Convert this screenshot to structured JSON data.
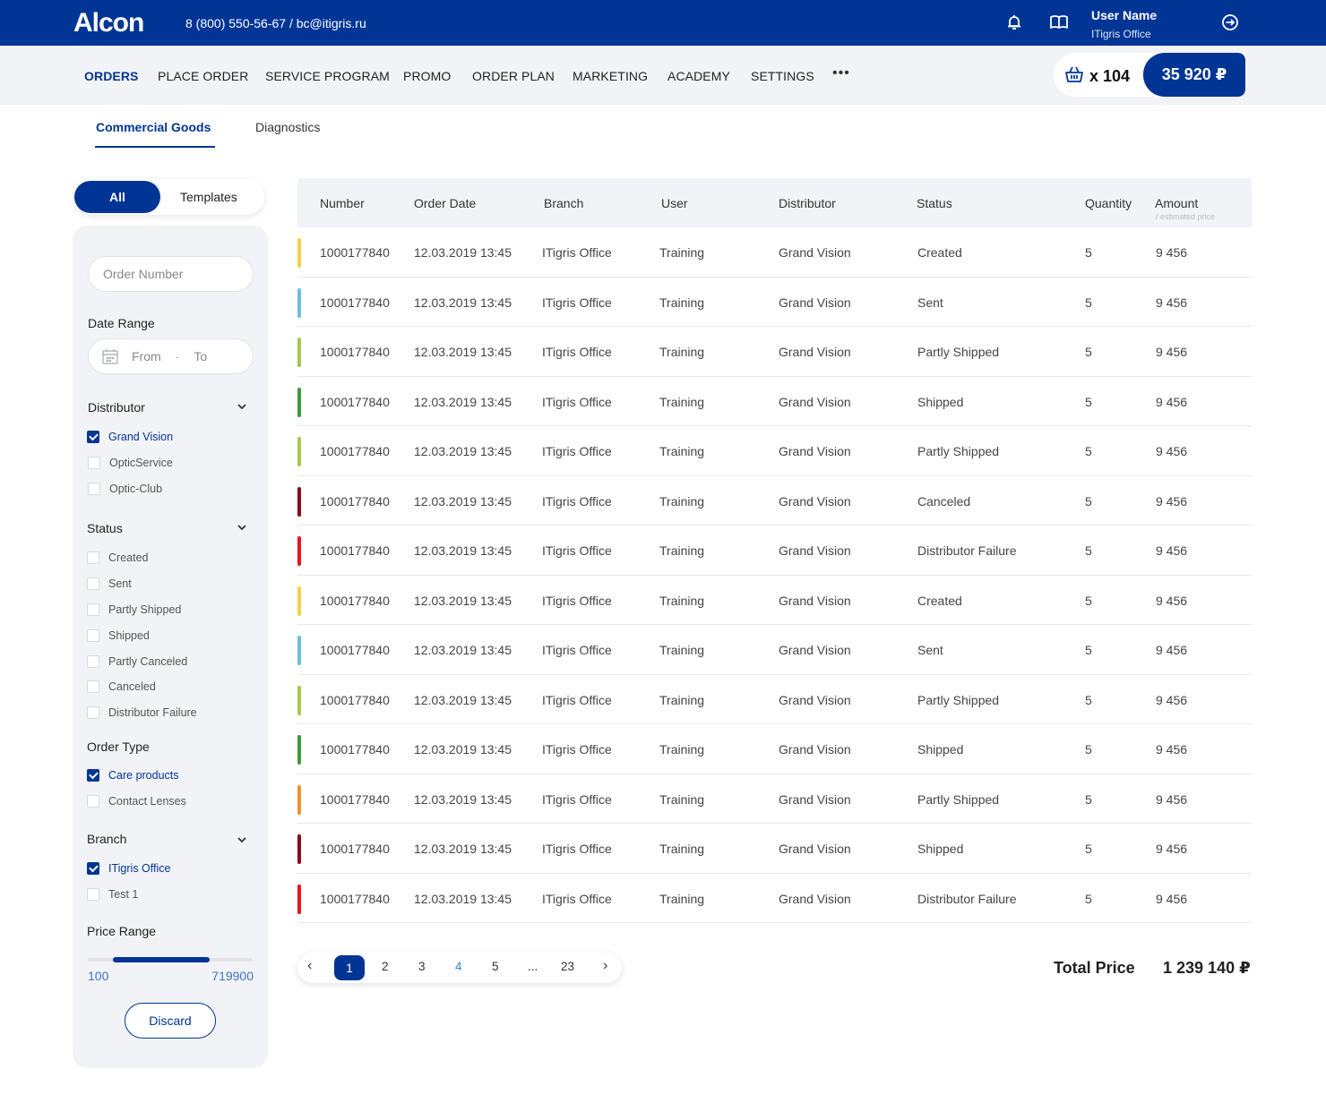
{
  "header": {
    "logo": "Alcon",
    "contact": "8 (800) 550-56-67 / bc@itigris.ru",
    "user_name": "User Name",
    "user_office": "ITigris Office"
  },
  "nav": {
    "items": [
      "ORDERS",
      "PLACE ORDER",
      "SERVICE PROGRAM",
      "PROMO",
      "ORDER PLAN",
      "MARKETING",
      "ACADEMY",
      "SETTINGS"
    ],
    "more": "•••",
    "cart_count": "x 104",
    "cart_total": "35 920 ₽"
  },
  "tabs": [
    "Commercial Goods",
    "Diagnostics"
  ],
  "segment": {
    "all": "All",
    "templates": "Templates"
  },
  "filters": {
    "order_number_placeholder": "Order Number",
    "date_range_label": "Date Range",
    "date_from": "From",
    "date_sep": "-",
    "date_to": "To",
    "distributor_label": "Distributor",
    "distributors": [
      {
        "label": "Grand Vision",
        "checked": true
      },
      {
        "label": "OpticService",
        "checked": false
      },
      {
        "label": "Optic-Club",
        "checked": false
      }
    ],
    "status_label": "Status",
    "statuses": [
      {
        "label": "Created",
        "checked": false
      },
      {
        "label": "Sent",
        "checked": false
      },
      {
        "label": "Partly Shipped",
        "checked": false
      },
      {
        "label": "Shipped",
        "checked": false
      },
      {
        "label": "Partly Canceled",
        "checked": false
      },
      {
        "label": "Canceled",
        "checked": false
      },
      {
        "label": "Distributor Failure",
        "checked": false
      }
    ],
    "order_type_label": "Order Type",
    "order_types": [
      {
        "label": "Care products",
        "checked": true
      },
      {
        "label": "Contact Lenses",
        "checked": false
      }
    ],
    "branch_label": "Branch",
    "branches": [
      {
        "label": "ITigris Office",
        "checked": true
      },
      {
        "label": "Test 1",
        "checked": false
      }
    ],
    "price_range_label": "Price Range",
    "price_min": "100",
    "price_max": "719900",
    "price_selected_fraction": [
      0.15,
      0.74
    ],
    "discard": "Discard"
  },
  "table": {
    "headers": [
      "Number",
      "Order Date",
      "Branch",
      "User",
      "Distributor",
      "Status",
      "Quantity",
      "Amount"
    ],
    "amount_sub": "/ estimated price",
    "status_colors": {
      "Created": "#f6d04d",
      "Sent": "#6cc0d6",
      "Partly Shipped": "#a4c94a",
      "Shipped": "#3d9a3d",
      "Canceled": "#8b0a1a",
      "Distributor Failure": "#e8141b",
      "Partly Shipped Alt": "#f0922e"
    },
    "rows": [
      {
        "number": "1000177840",
        "date": "12.03.2019 13:45",
        "branch": "ITigris Office",
        "user": "Training",
        "distributor": "Grand Vision",
        "status": "Created",
        "quantity": "5",
        "amount": "9 456",
        "color": "#f6d04d"
      },
      {
        "number": "1000177840",
        "date": "12.03.2019 13:45",
        "branch": "ITigris Office",
        "user": "Training",
        "distributor": "Grand Vision",
        "status": "Sent",
        "quantity": "5",
        "amount": "9 456",
        "color": "#6cc0d6"
      },
      {
        "number": "1000177840",
        "date": "12.03.2019 13:45",
        "branch": "ITigris Office",
        "user": "Training",
        "distributor": "Grand Vision",
        "status": "Partly Shipped",
        "quantity": "5",
        "amount": "9 456",
        "color": "#a4c94a"
      },
      {
        "number": "1000177840",
        "date": "12.03.2019 13:45",
        "branch": "ITigris Office",
        "user": "Training",
        "distributor": "Grand Vision",
        "status": "Shipped",
        "quantity": "5",
        "amount": "9 456",
        "color": "#3d9a3d"
      },
      {
        "number": "1000177840",
        "date": "12.03.2019 13:45",
        "branch": "ITigris Office",
        "user": "Training",
        "distributor": "Grand Vision",
        "status": "Partly Shipped",
        "quantity": "5",
        "amount": "9 456",
        "color": "#a4c94a"
      },
      {
        "number": "1000177840",
        "date": "12.03.2019 13:45",
        "branch": "ITigris Office",
        "user": "Training",
        "distributor": "Grand Vision",
        "status": "Canceled",
        "quantity": "5",
        "amount": "9 456",
        "color": "#8b0a1a"
      },
      {
        "number": "1000177840",
        "date": "12.03.2019 13:45",
        "branch": "ITigris Office",
        "user": "Training",
        "distributor": "Grand Vision",
        "status": "Distributor Failure",
        "quantity": "5",
        "amount": "9 456",
        "color": "#e8141b"
      },
      {
        "number": "1000177840",
        "date": "12.03.2019 13:45",
        "branch": "ITigris Office",
        "user": "Training",
        "distributor": "Grand Vision",
        "status": "Created",
        "quantity": "5",
        "amount": "9 456",
        "color": "#f6d04d"
      },
      {
        "number": "1000177840",
        "date": "12.03.2019 13:45",
        "branch": "ITigris Office",
        "user": "Training",
        "distributor": "Grand Vision",
        "status": "Sent",
        "quantity": "5",
        "amount": "9 456",
        "color": "#6cc0d6"
      },
      {
        "number": "1000177840",
        "date": "12.03.2019 13:45",
        "branch": "ITigris Office",
        "user": "Training",
        "distributor": "Grand Vision",
        "status": "Partly Shipped",
        "quantity": "5",
        "amount": "9 456",
        "color": "#a4c94a"
      },
      {
        "number": "1000177840",
        "date": "12.03.2019 13:45",
        "branch": "ITigris Office",
        "user": "Training",
        "distributor": "Grand Vision",
        "status": "Shipped",
        "quantity": "5",
        "amount": "9 456",
        "color": "#3d9a3d"
      },
      {
        "number": "1000177840",
        "date": "12.03.2019 13:45",
        "branch": "ITigris Office",
        "user": "Training",
        "distributor": "Grand Vision",
        "status": "Partly Shipped",
        "quantity": "5",
        "amount": "9 456",
        "color": "#f0922e"
      },
      {
        "number": "1000177840",
        "date": "12.03.2019 13:45",
        "branch": "ITigris Office",
        "user": "Training",
        "distributor": "Grand Vision",
        "status": "Shipped",
        "quantity": "5",
        "amount": "9 456",
        "color": "#8b0a1a"
      },
      {
        "number": "1000177840",
        "date": "12.03.2019 13:45",
        "branch": "ITigris Office",
        "user": "Training",
        "distributor": "Grand Vision",
        "status": "Distributor Failure",
        "quantity": "5",
        "amount": "9 456",
        "color": "#e8141b"
      }
    ]
  },
  "pagination": {
    "prev": "‹",
    "pages": [
      "1",
      "2",
      "3",
      "4",
      "5",
      "...",
      "23"
    ],
    "current": "1",
    "highlight": "4",
    "next": "›"
  },
  "total": {
    "label": "Total Price",
    "value": "1 239 140 ₽"
  }
}
